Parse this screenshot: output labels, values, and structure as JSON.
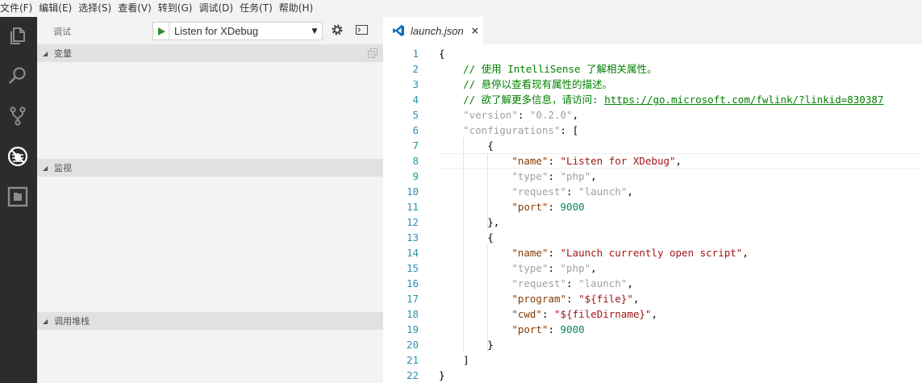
{
  "menu": [
    "文件(F)",
    "编辑(E)",
    "选择(S)",
    "查看(V)",
    "转到(G)",
    "调试(D)",
    "任务(T)",
    "帮助(H)"
  ],
  "activity_bar": {
    "icons": [
      "explorer-icon",
      "search-icon",
      "source-control-icon",
      "debug-icon",
      "extensions-icon"
    ],
    "active": "debug-icon"
  },
  "debug": {
    "title": "调试",
    "configuration": "Listen for XDebug",
    "sections": {
      "variables": "变量",
      "watch": "监视",
      "call_stack": "调用堆栈"
    }
  },
  "editor": {
    "tab_label": "launch.json",
    "close_glyph": "×",
    "cursor_line": 8,
    "lines": [
      [
        [
          "{",
          "punc"
        ]
      ],
      [
        [
          "    // 使用 IntelliSense 了解相关属性。",
          "comment"
        ]
      ],
      [
        [
          "    // 悬停以查看现有属性的描述。",
          "comment"
        ]
      ],
      [
        [
          "    // 欲了解更多信息，请访问: ",
          "comment"
        ],
        [
          "https://go.microsoft.com/fwlink/?linkid=830387",
          "link"
        ]
      ],
      [
        [
          "    ",
          "punc"
        ],
        [
          "\"version\"",
          "key-def"
        ],
        [
          ": ",
          "punc"
        ],
        [
          "\"0.2.0\"",
          "str-def"
        ],
        [
          ",",
          "punc"
        ]
      ],
      [
        [
          "    ",
          "punc"
        ],
        [
          "\"configurations\"",
          "key-def"
        ],
        [
          ": [",
          "punc"
        ]
      ],
      [
        [
          "        {",
          "punc"
        ]
      ],
      [
        [
          "            ",
          "punc"
        ],
        [
          "\"name\"",
          "key"
        ],
        [
          ": ",
          "punc"
        ],
        [
          "\"Listen for XDebug\"",
          "str"
        ],
        [
          ",",
          "punc"
        ]
      ],
      [
        [
          "            ",
          "punc"
        ],
        [
          "\"type\"",
          "key-def"
        ],
        [
          ": ",
          "punc"
        ],
        [
          "\"php\"",
          "str-def"
        ],
        [
          ",",
          "punc"
        ]
      ],
      [
        [
          "            ",
          "punc"
        ],
        [
          "\"request\"",
          "key-def"
        ],
        [
          ": ",
          "punc"
        ],
        [
          "\"launch\"",
          "str-def"
        ],
        [
          ",",
          "punc"
        ]
      ],
      [
        [
          "            ",
          "punc"
        ],
        [
          "\"port\"",
          "key"
        ],
        [
          ": ",
          "punc"
        ],
        [
          "9000",
          "num"
        ]
      ],
      [
        [
          "        },",
          "punc"
        ]
      ],
      [
        [
          "        {",
          "punc"
        ]
      ],
      [
        [
          "            ",
          "punc"
        ],
        [
          "\"name\"",
          "key"
        ],
        [
          ": ",
          "punc"
        ],
        [
          "\"Launch currently open script\"",
          "str"
        ],
        [
          ",",
          "punc"
        ]
      ],
      [
        [
          "            ",
          "punc"
        ],
        [
          "\"type\"",
          "key-def"
        ],
        [
          ": ",
          "punc"
        ],
        [
          "\"php\"",
          "str-def"
        ],
        [
          ",",
          "punc"
        ]
      ],
      [
        [
          "            ",
          "punc"
        ],
        [
          "\"request\"",
          "key-def"
        ],
        [
          ": ",
          "punc"
        ],
        [
          "\"launch\"",
          "str-def"
        ],
        [
          ",",
          "punc"
        ]
      ],
      [
        [
          "            ",
          "punc"
        ],
        [
          "\"program\"",
          "key"
        ],
        [
          ": ",
          "punc"
        ],
        [
          "\"${file}\"",
          "str"
        ],
        [
          ",",
          "punc"
        ]
      ],
      [
        [
          "            ",
          "punc"
        ],
        [
          "\"cwd\"",
          "key"
        ],
        [
          ": ",
          "punc"
        ],
        [
          "\"${fileDirname}\"",
          "str"
        ],
        [
          ",",
          "punc"
        ]
      ],
      [
        [
          "            ",
          "punc"
        ],
        [
          "\"port\"",
          "key"
        ],
        [
          ": ",
          "punc"
        ],
        [
          "9000",
          "num"
        ]
      ],
      [
        [
          "        }",
          "punc"
        ]
      ],
      [
        [
          "    ]",
          "punc"
        ]
      ],
      [
        [
          "}",
          "punc"
        ]
      ]
    ]
  }
}
